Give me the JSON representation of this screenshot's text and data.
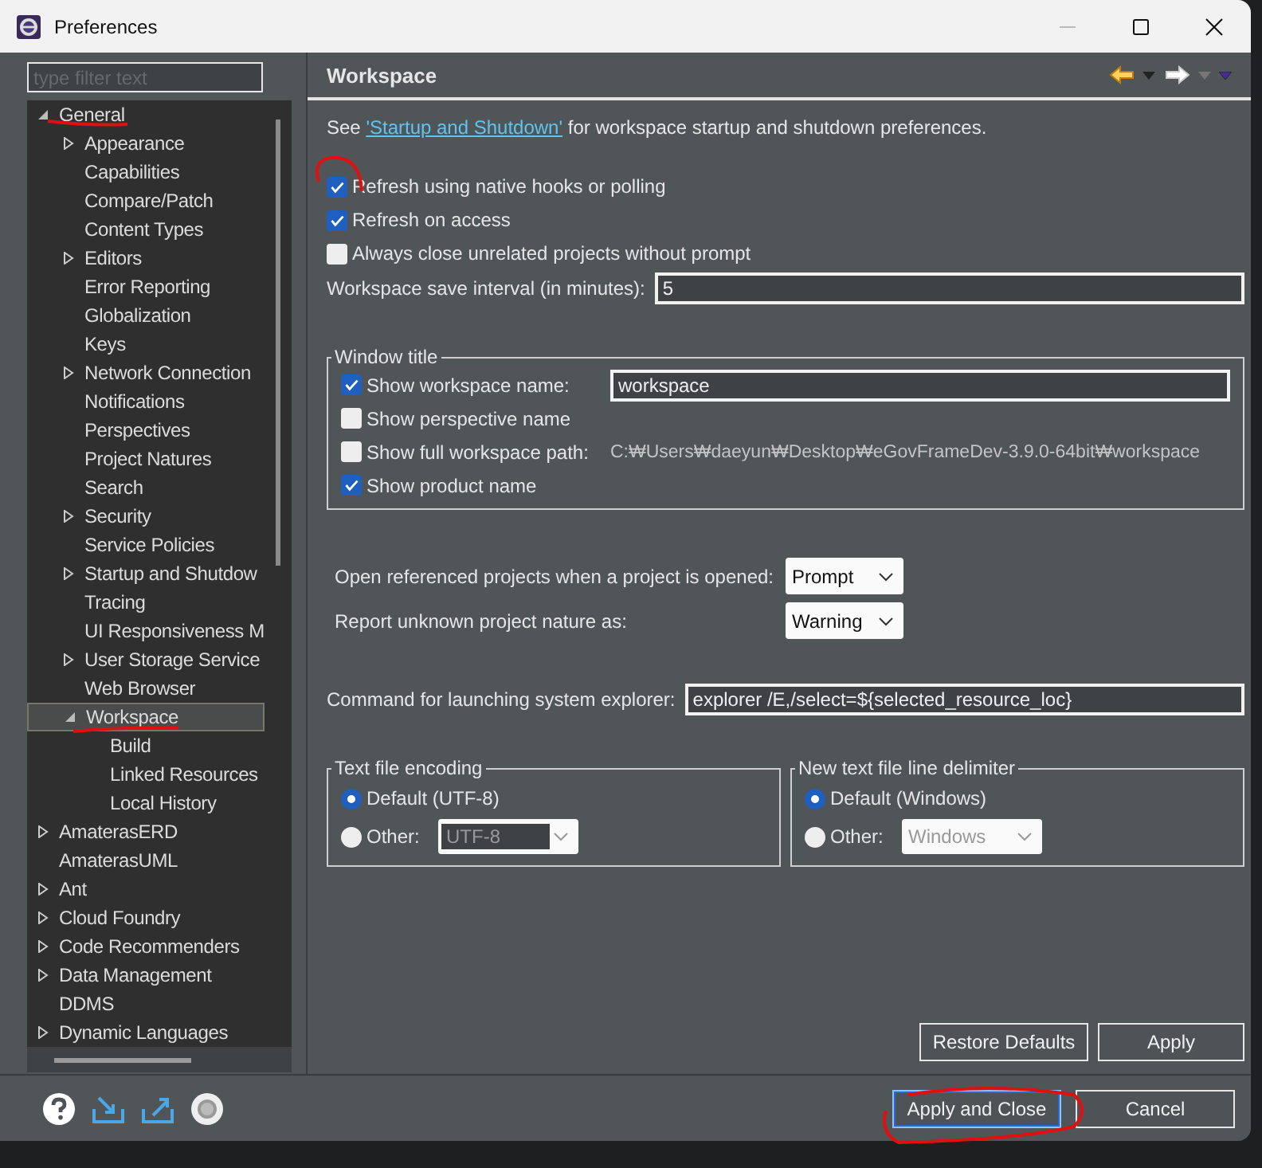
{
  "window": {
    "title": "Preferences"
  },
  "filter": {
    "placeholder": "type filter text"
  },
  "tree": [
    {
      "label": "General",
      "expanded": true,
      "selected": false,
      "children": [
        {
          "label": "Appearance",
          "expandable": true,
          "expanded": false,
          "selected": false
        },
        {
          "label": "Capabilities",
          "expandable": false,
          "expanded": false,
          "selected": false
        },
        {
          "label": "Compare/Patch",
          "expandable": false,
          "expanded": false,
          "selected": false
        },
        {
          "label": "Content Types",
          "expandable": false,
          "expanded": false,
          "selected": false
        },
        {
          "label": "Editors",
          "expandable": true,
          "expanded": false,
          "selected": false
        },
        {
          "label": "Error Reporting",
          "expandable": false,
          "expanded": false,
          "selected": false
        },
        {
          "label": "Globalization",
          "expandable": false,
          "expanded": false,
          "selected": false
        },
        {
          "label": "Keys",
          "expandable": false,
          "expanded": false,
          "selected": false
        },
        {
          "label": "Network Connection",
          "expandable": true,
          "expanded": false,
          "selected": false
        },
        {
          "label": "Notifications",
          "expandable": false,
          "expanded": false,
          "selected": false
        },
        {
          "label": "Perspectives",
          "expandable": false,
          "expanded": false,
          "selected": false
        },
        {
          "label": "Project Natures",
          "expandable": false,
          "expanded": false,
          "selected": false
        },
        {
          "label": "Search",
          "expandable": false,
          "expanded": false,
          "selected": false
        },
        {
          "label": "Security",
          "expandable": true,
          "expanded": false,
          "selected": false
        },
        {
          "label": "Service Policies",
          "expandable": false,
          "expanded": false,
          "selected": false
        },
        {
          "label": "Startup and Shutdow",
          "expandable": true,
          "expanded": false,
          "selected": false
        },
        {
          "label": "Tracing",
          "expandable": false,
          "expanded": false,
          "selected": false
        },
        {
          "label": "UI Responsiveness M",
          "expandable": false,
          "expanded": false,
          "selected": false
        },
        {
          "label": "User Storage Service",
          "expandable": true,
          "expanded": false,
          "selected": false
        },
        {
          "label": "Web Browser",
          "expandable": false,
          "expanded": false,
          "selected": false
        },
        {
          "label": "Workspace",
          "expanded": true,
          "selected": true,
          "children": [
            {
              "label": "Build",
              "expandable": false,
              "expanded": false,
              "selected": false
            },
            {
              "label": "Linked Resources",
              "expandable": false,
              "expanded": false,
              "selected": false
            },
            {
              "label": "Local History",
              "expandable": false,
              "expanded": false,
              "selected": false
            }
          ]
        }
      ]
    },
    {
      "label": "AmaterasERD",
      "expandable": true,
      "expanded": false,
      "selected": false
    },
    {
      "label": "AmaterasUML",
      "expandable": false,
      "expanded": false,
      "selected": false
    },
    {
      "label": "Ant",
      "expandable": true,
      "expanded": false,
      "selected": false
    },
    {
      "label": "Cloud Foundry",
      "expandable": true,
      "expanded": false,
      "selected": false
    },
    {
      "label": "Code Recommenders",
      "expandable": true,
      "expanded": false,
      "selected": false
    },
    {
      "label": "Data Management",
      "expandable": true,
      "expanded": false,
      "selected": false
    },
    {
      "label": "DDMS",
      "expandable": false,
      "expanded": false,
      "selected": false
    },
    {
      "label": "Dynamic Languages",
      "expandable": true,
      "expanded": false,
      "selected": false
    }
  ],
  "page": {
    "title": "Workspace",
    "intro": {
      "before": "See ",
      "link": "'Startup and Shutdown'",
      "after": " for workspace startup and shutdown preferences."
    },
    "options": [
      {
        "label": "Refresh using native hooks or polling",
        "checked": true
      },
      {
        "label": "Refresh on access",
        "checked": true
      },
      {
        "label": "Always close unrelated projects without prompt",
        "checked": false
      }
    ],
    "save_interval": {
      "label": "Workspace save interval (in minutes):",
      "value": "5"
    },
    "window_title": {
      "legend": "Window title",
      "options": [
        {
          "kind": "field",
          "label": "Show workspace name:",
          "checked": true,
          "value": "workspace"
        },
        {
          "kind": "plain",
          "label": "Show perspective name",
          "checked": false
        },
        {
          "kind": "path",
          "label": "Show full workspace path:",
          "checked": false,
          "value": "C:₩Users₩daeyun₩Desktop₩eGovFrameDev-3.9.0-64bit₩workspace"
        },
        {
          "kind": "plain",
          "label": "Show product name",
          "checked": true
        }
      ]
    },
    "selects": [
      {
        "label": "Open referenced projects when a project is opened:",
        "value": "Prompt"
      },
      {
        "label": "Report unknown project nature as:",
        "value": "Warning"
      }
    ],
    "explorer": {
      "label": "Command for launching system explorer:",
      "value": "explorer /E,/select=${selected_resource_loc}"
    },
    "groups": [
      {
        "legend": "Text file encoding",
        "options": [
          {
            "label": "Default (UTF-8)",
            "selected": true
          },
          {
            "label": "Other:",
            "selected": false,
            "select": "UTF-8",
            "disabled": true
          }
        ]
      },
      {
        "legend": "New text file line delimiter",
        "options": [
          {
            "label": "Default (Windows)",
            "selected": true
          },
          {
            "label": "Other:",
            "selected": false,
            "select": "Windows",
            "disabled": true
          }
        ]
      }
    ],
    "buttons": [
      "Restore Defaults",
      "Apply"
    ]
  },
  "footer_buttons": [
    {
      "label": "Apply and Close",
      "default": true
    },
    {
      "label": "Cancel",
      "default": false
    }
  ]
}
